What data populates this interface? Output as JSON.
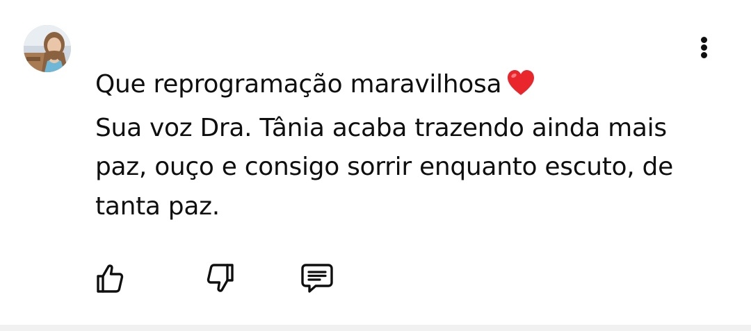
{
  "comment": {
    "author_avatar_icon": "user-avatar-photo",
    "text_lines": [
      "Que reprogramação maravilhosa",
      "Sua voz Dra. Tânia acaba trazendo ainda mais",
      "paz, ouço e consigo sorrir enquanto escuto, de",
      "tanta paz."
    ],
    "emoji": "heart-emoji",
    "accent_color": "#e8262c"
  },
  "actions": {
    "like_icon": "thumbs-up-icon",
    "dislike_icon": "thumbs-down-icon",
    "reply_icon": "comment-icon",
    "more_icon": "more-vertical-icon"
  }
}
